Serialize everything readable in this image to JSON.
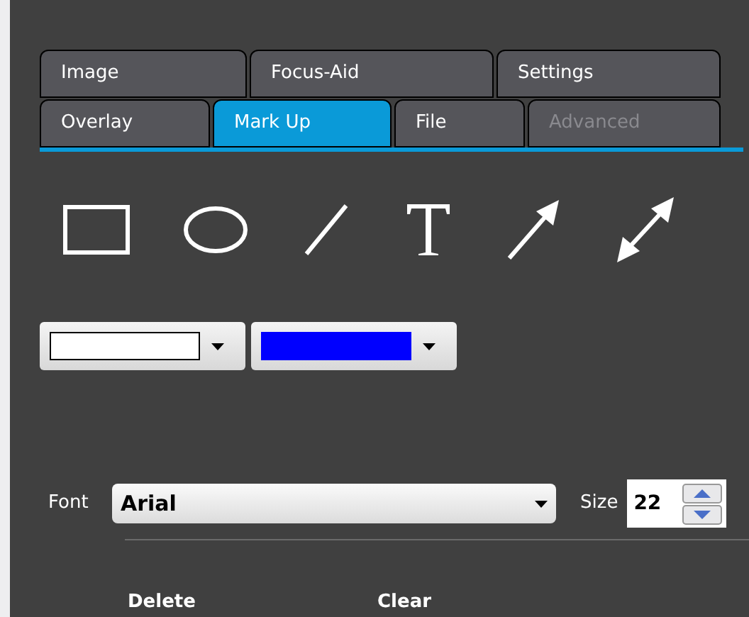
{
  "tab_rows": [
    [
      {
        "label": "Image",
        "selected": false,
        "disabled": false
      },
      {
        "label": "Focus-Aid",
        "selected": false,
        "disabled": false
      },
      {
        "label": "Settings",
        "selected": false,
        "disabled": false
      }
    ],
    [
      {
        "label": "Overlay",
        "selected": false,
        "disabled": false
      },
      {
        "label": "Mark Up",
        "selected": true,
        "disabled": false
      },
      {
        "label": "File",
        "selected": false,
        "disabled": false
      },
      {
        "label": "Advanced",
        "selected": false,
        "disabled": true
      }
    ]
  ],
  "tools": [
    {
      "kind": "rectangle"
    },
    {
      "kind": "ellipse"
    },
    {
      "kind": "line"
    },
    {
      "kind": "text"
    },
    {
      "kind": "arrow"
    },
    {
      "kind": "double-arrow"
    }
  ],
  "color_pickers": [
    {
      "color": "#ffffff"
    },
    {
      "color": "#0000ff"
    }
  ],
  "font": {
    "label": "Font",
    "value": "Arial"
  },
  "size": {
    "label": "Size",
    "value": "22"
  },
  "buttons": [
    "Delete",
    "Clear"
  ]
}
